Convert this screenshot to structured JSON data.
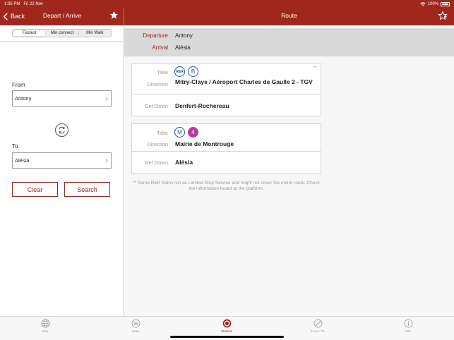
{
  "status_bar": {
    "time": "1:05 PM",
    "date": "Fri 22 Nov",
    "battery": "100%"
  },
  "left_nav": {
    "back_label": "Back",
    "title": "Depart / Arrive"
  },
  "right_nav": {
    "title": "Route"
  },
  "segmented": {
    "options": [
      "Fastest",
      "Min connect",
      "Min Walk"
    ],
    "selected": "Fastest"
  },
  "form": {
    "from_label": "From",
    "from_value": "Antony",
    "to_label": "To",
    "to_value": "Alésia",
    "clear_label": "Clear",
    "search_label": "Search"
  },
  "summary": {
    "departure_label": "Departure",
    "departure_value": "Antony",
    "arrival_label": "Arrival",
    "arrival_value": "Alésia"
  },
  "legs": [
    {
      "take_label": "Take",
      "badges": [
        "RER",
        "B"
      ],
      "direction_label": "Direction",
      "direction_value": "Mitry-Claye / Aéroport Charles de Gaulle 2 - TGV",
      "getdown_label": "Get Down",
      "getdown_value": "Denfert-Rochereau",
      "marker": "**"
    },
    {
      "take_label": "Take",
      "badges": [
        "M",
        "4"
      ],
      "direction_label": "Direction",
      "direction_value": "Mairie de Montrouge",
      "getdown_label": "Get Down",
      "getdown_value": "Alésia"
    }
  ],
  "note": "** Some RER trains run as Limited Stop Service and might not cover the entire route. Check the information board at the platform.",
  "tabs": [
    {
      "label": "Map",
      "icon": "globe-icon"
    },
    {
      "label": "Lines",
      "icon": "lines-icon"
    },
    {
      "label": "Stations",
      "icon": "station-icon",
      "active": true
    },
    {
      "label": "From / To",
      "icon": "route-icon"
    },
    {
      "label": "Info",
      "icon": "info-icon"
    }
  ],
  "colors": {
    "brand_red": "#a0271c",
    "rer_blue": "#1a5aa8",
    "metro4_purple": "#bb3b9c"
  }
}
